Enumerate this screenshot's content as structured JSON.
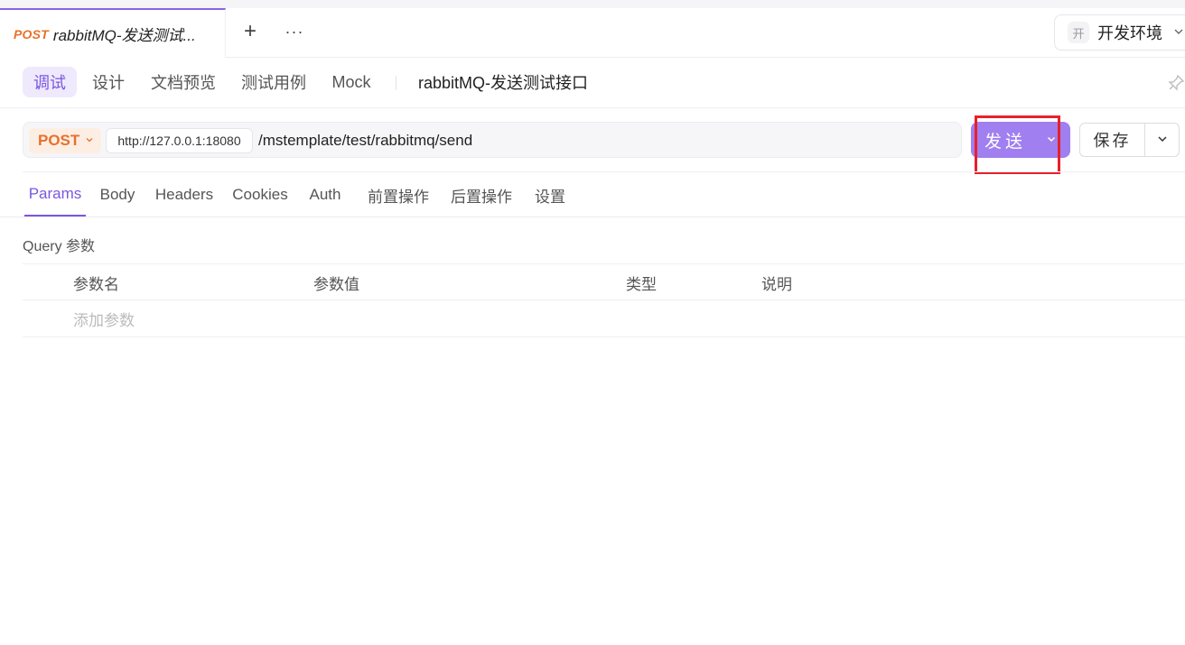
{
  "tab": {
    "method": "POST",
    "title": "rabbitMQ-发送测试..."
  },
  "tab_actions": {
    "add": "+",
    "more": "···"
  },
  "environment": {
    "badge": "开",
    "label": "开发环境"
  },
  "subnav": {
    "items": [
      {
        "label": "调试",
        "active": true
      },
      {
        "label": "设计"
      },
      {
        "label": "文档预览"
      },
      {
        "label": "测试用例"
      },
      {
        "label": "Mock"
      }
    ],
    "api_name": "rabbitMQ-发送测试接口"
  },
  "request": {
    "method": "POST",
    "base_url": "http://127.0.0.1:18080",
    "path": "/mstemplate/test/rabbitmq/send",
    "send_label": "发送",
    "save_label": "保存"
  },
  "param_tabs": [
    {
      "label": "Params",
      "active": true
    },
    {
      "label": "Body"
    },
    {
      "label": "Headers"
    },
    {
      "label": "Cookies"
    },
    {
      "label": "Auth"
    },
    {
      "label": "前置操作"
    },
    {
      "label": "后置操作"
    },
    {
      "label": "设置"
    }
  ],
  "query": {
    "title": "Query 参数",
    "columns": [
      "参数名",
      "参数值",
      "类型",
      "说明"
    ],
    "add_placeholder": "添加参数"
  },
  "colors": {
    "accent": "#7b56e0",
    "send_button": "#a07ff0",
    "method": "#e8702a",
    "highlight": "#e8202a"
  },
  "icons": [
    "plus-icon",
    "more-icon",
    "chevron-down-icon",
    "pin-icon"
  ]
}
